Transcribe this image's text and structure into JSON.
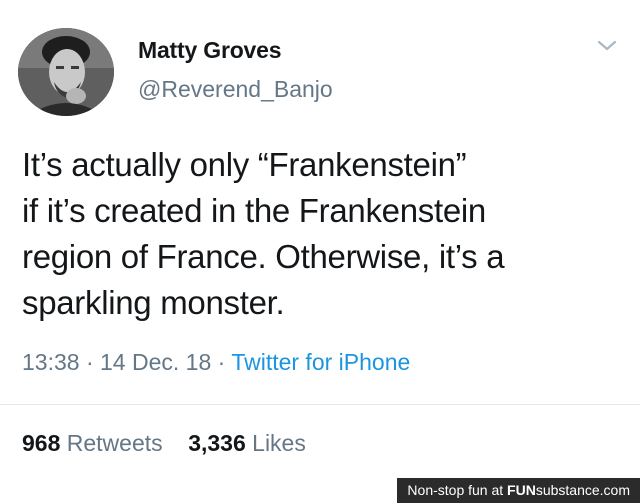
{
  "tweet": {
    "display_name": "Matty Groves",
    "handle": "@Reverend_Banjo",
    "text": "It’s actually only “Frankenstein”\nif it’s created in the Frankenstein\nregion of France. Otherwise, it’s a\nsparkling monster.",
    "time": "13:38",
    "date": "14 Dec. 18",
    "separator": "·",
    "source": "Twitter for iPhone",
    "retweets_count": "968",
    "retweets_label": "Retweets",
    "likes_count": "3,336",
    "likes_label": "Likes",
    "menu_icon": "chevron-down-icon",
    "avatar": "avatar-photo"
  },
  "watermark": {
    "text": "Non-stop fun at ",
    "brand_bold": "FUN",
    "brand_rest": "substance.com"
  },
  "colors": {
    "text": "#14171a",
    "muted": "#657786",
    "link": "#1b95e0",
    "watermark_bg": "#2b2b2b"
  }
}
